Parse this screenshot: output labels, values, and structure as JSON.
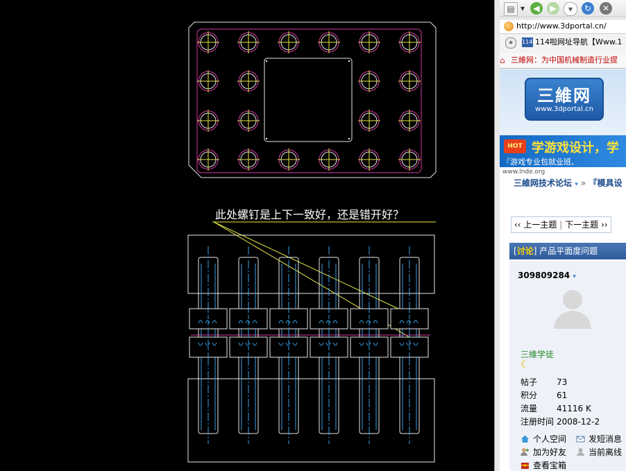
{
  "cad": {
    "annotation": "此处螺钉是上下一致好，还是错开好？"
  },
  "browser": {
    "address": "http://www.3dportal.cn/",
    "bookmark_label": "114啦网址导航【Www.1",
    "bookmark_tag": "114啦",
    "tab_title": "三維网：为中国机械制造行业提",
    "logo_text": "三維网",
    "logo_url": "www.3dportal.cn",
    "ad_badge": "HOT",
    "ad_line1": "学游戏设计，学",
    "ad_line2": "『游戏专业包就业班、",
    "ad_footer": "www.lnde.org",
    "breadcrumb_forum": "三維网技术论坛",
    "breadcrumb_sep": "»",
    "breadcrumb_sub": "『模具设",
    "prev_topic": "‹‹ 上一主题",
    "next_topic": "下一主题 ››",
    "topic_tag": "讨论",
    "topic_title": "产品平面度问题",
    "username": "309809284",
    "rank": "三維学徒",
    "stats": [
      {
        "label": "帖子",
        "value": "73"
      },
      {
        "label": "积分",
        "value": "61"
      },
      {
        "label": "流量",
        "value": "41116 K"
      },
      {
        "label": "注册时间",
        "value": "2008-12-2"
      }
    ],
    "actions": {
      "space": "个人空间",
      "message": "发短消息",
      "friend": "加为好友",
      "status": "当前离线",
      "treasure": "查看宝箱"
    }
  }
}
